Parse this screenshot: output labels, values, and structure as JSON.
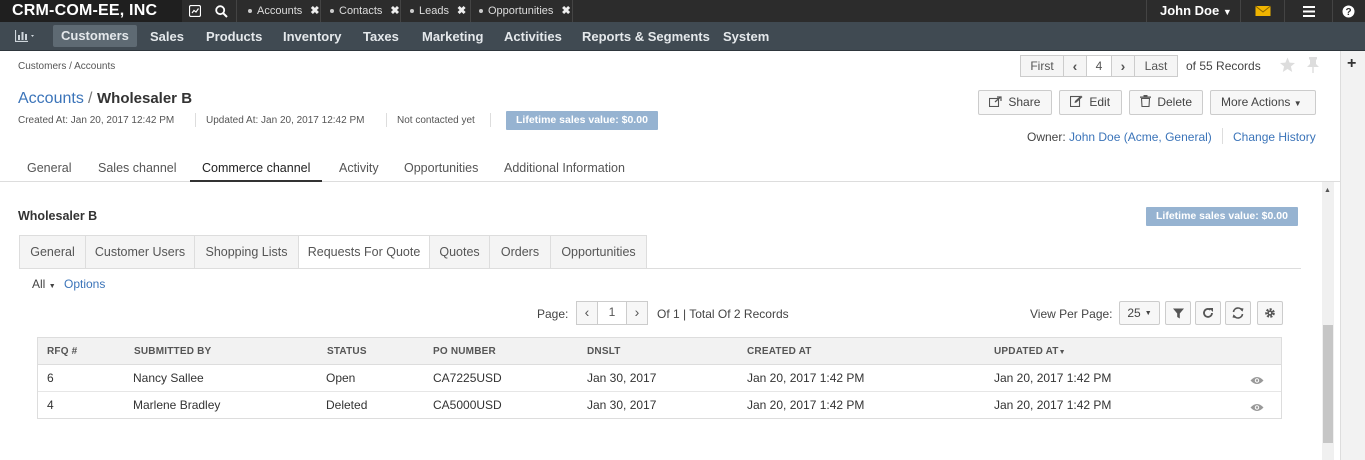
{
  "topbar": {
    "org_name": "CRM-COM-EE, INC",
    "pinned": [
      {
        "label": "Accounts"
      },
      {
        "label": "Contacts"
      },
      {
        "label": "Leads"
      },
      {
        "label": "Opportunities"
      }
    ],
    "user_name": "John Doe"
  },
  "menu": {
    "items": [
      "Customers",
      "Sales",
      "Products",
      "Inventory",
      "Taxes",
      "Marketing",
      "Activities",
      "Reports & Segments",
      "System"
    ]
  },
  "breadcrumb": "Customers / Accounts",
  "pager_top": {
    "first": "First",
    "current": "4",
    "last": "Last",
    "records": "of 55 Records"
  },
  "page": {
    "title_link": "Accounts",
    "title_sep": "/",
    "title_name": "Wholesaler B",
    "created": "Created At: Jan 20, 2017 12:42 PM",
    "updated": "Updated At: Jan 20, 2017 12:42 PM",
    "contacted": "Not contacted yet",
    "lifetime": "Lifetime sales value: $0.00",
    "actions": {
      "share": "Share",
      "edit": "Edit",
      "delete": "Delete",
      "more": "More Actions"
    },
    "owner_label": "Owner:",
    "owner_name": "John Doe",
    "owner_org": "(Acme, General)",
    "change_history": "Change History"
  },
  "tabs": [
    "General",
    "Sales channel",
    "Commerce channel",
    "Activity",
    "Opportunities",
    "Additional Information"
  ],
  "section": {
    "title": "Wholesaler B",
    "lifetime": "Lifetime sales value: $0.00",
    "subtabs": [
      "General",
      "Customer Users",
      "Shopping Lists",
      "Requests For Quote",
      "Quotes",
      "Orders",
      "Opportunities"
    ]
  },
  "grid_controls": {
    "filter_all": "All",
    "options": "Options",
    "page_label": "Page:",
    "page_value": "1",
    "page_total": "Of 1 | Total Of 2 Records",
    "view_per_page_label": "View Per Page:",
    "view_per_page_value": "25"
  },
  "table": {
    "headers": [
      "RFQ #",
      "SUBMITTED BY",
      "STATUS",
      "PO NUMBER",
      "DNSLT",
      "CREATED AT",
      "UPDATED AT"
    ],
    "rows": [
      {
        "rfq": "6",
        "submitted_by": "Nancy Sallee",
        "status": "Open",
        "po": "CA7225USD",
        "dnslt": "Jan 30, 2017",
        "created": "Jan 20, 2017 1:42 PM",
        "updated": "Jan 20, 2017 1:42 PM"
      },
      {
        "rfq": "4",
        "submitted_by": "Marlene Bradley",
        "status": "Deleted",
        "po": "CA5000USD",
        "dnslt": "Jan 30, 2017",
        "created": "Jan 20, 2017 1:42 PM",
        "updated": "Jan 20, 2017 1:42 PM"
      }
    ]
  },
  "colors": {
    "topbar": "#2c2c2c",
    "menubar": "#404a52",
    "link": "#3b74b9",
    "badge": "#96b3d1"
  }
}
